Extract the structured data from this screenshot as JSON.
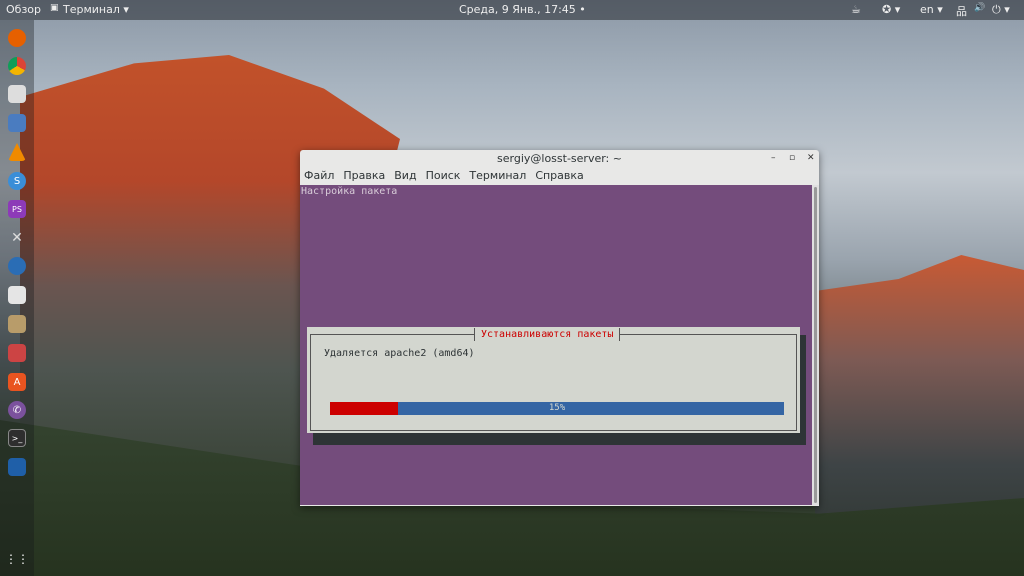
{
  "topbar": {
    "activities": "Обзор",
    "app_menu": "Терминал ▾",
    "clock": "Среда, 9 Янв., 17:45 •",
    "lang": "en ▾",
    "a11y": "✪ ▾",
    "power": "⏻ ▾",
    "net": "品",
    "vol": "🔊"
  },
  "dock": {
    "items": [
      "firefox-icon",
      "chrome-icon",
      "tweak-icon",
      "files-icon",
      "vlc-icon",
      "simplenote-icon",
      "phpstorm-icon",
      "tools-icon",
      "thunderbird-icon",
      "calculator-icon",
      "image-viewer-icon",
      "installer-icon",
      "software-center-icon",
      "viber-icon",
      "terminal-icon",
      "virtualbox-icon"
    ],
    "apps_grid": "⋮⋮"
  },
  "window": {
    "title": "sergiy@losst-server: ~",
    "menu": [
      "Файл",
      "Правка",
      "Вид",
      "Поиск",
      "Терминал",
      "Справка"
    ],
    "terminal_header": "Настройка пакета",
    "dialog": {
      "title": "Устанавливаются пакеты",
      "message": "Удаляется apache2 (amd64)",
      "progress_percent": 15,
      "progress_label": "15%"
    }
  },
  "colors": {
    "terminal_bg": "#744c7c",
    "dialog_bg": "#d3d6cf",
    "progress_fill": "#cc0000",
    "progress_bg": "#3465a4"
  }
}
